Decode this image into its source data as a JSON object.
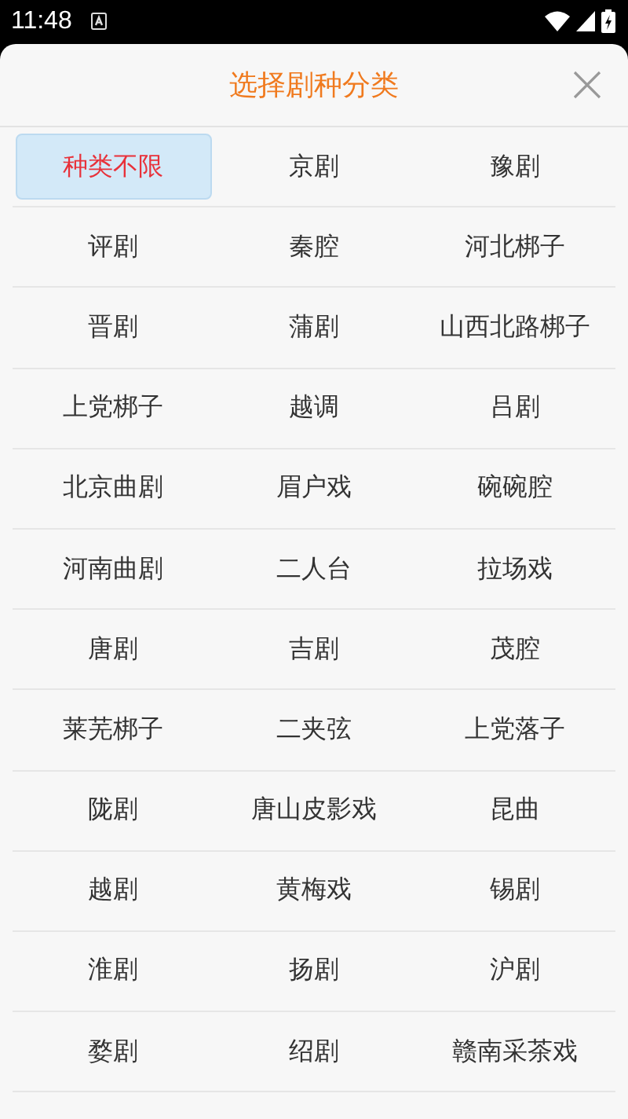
{
  "status_bar": {
    "time": "11:48"
  },
  "dialog": {
    "title": "选择剧种分类"
  },
  "categories": [
    {
      "label": "种类不限",
      "selected": true
    },
    {
      "label": "京剧",
      "selected": false
    },
    {
      "label": "豫剧",
      "selected": false
    },
    {
      "label": "评剧",
      "selected": false
    },
    {
      "label": "秦腔",
      "selected": false
    },
    {
      "label": "河北梆子",
      "selected": false
    },
    {
      "label": "晋剧",
      "selected": false
    },
    {
      "label": "蒲剧",
      "selected": false
    },
    {
      "label": "山西北路梆子",
      "selected": false
    },
    {
      "label": "上党梆子",
      "selected": false
    },
    {
      "label": "越调",
      "selected": false
    },
    {
      "label": "吕剧",
      "selected": false
    },
    {
      "label": "北京曲剧",
      "selected": false
    },
    {
      "label": "眉户戏",
      "selected": false
    },
    {
      "label": "碗碗腔",
      "selected": false
    },
    {
      "label": "河南曲剧",
      "selected": false
    },
    {
      "label": "二人台",
      "selected": false
    },
    {
      "label": "拉场戏",
      "selected": false
    },
    {
      "label": "唐剧",
      "selected": false
    },
    {
      "label": "吉剧",
      "selected": false
    },
    {
      "label": "茂腔",
      "selected": false
    },
    {
      "label": "莱芜梆子",
      "selected": false
    },
    {
      "label": "二夹弦",
      "selected": false
    },
    {
      "label": "上党落子",
      "selected": false
    },
    {
      "label": "陇剧",
      "selected": false
    },
    {
      "label": "唐山皮影戏",
      "selected": false
    },
    {
      "label": "昆曲",
      "selected": false
    },
    {
      "label": "越剧",
      "selected": false
    },
    {
      "label": "黄梅戏",
      "selected": false
    },
    {
      "label": "锡剧",
      "selected": false
    },
    {
      "label": "淮剧",
      "selected": false
    },
    {
      "label": "扬剧",
      "selected": false
    },
    {
      "label": "沪剧",
      "selected": false
    },
    {
      "label": "婺剧",
      "selected": false
    },
    {
      "label": "绍剧",
      "selected": false
    },
    {
      "label": "赣南采茶戏",
      "selected": false
    }
  ]
}
